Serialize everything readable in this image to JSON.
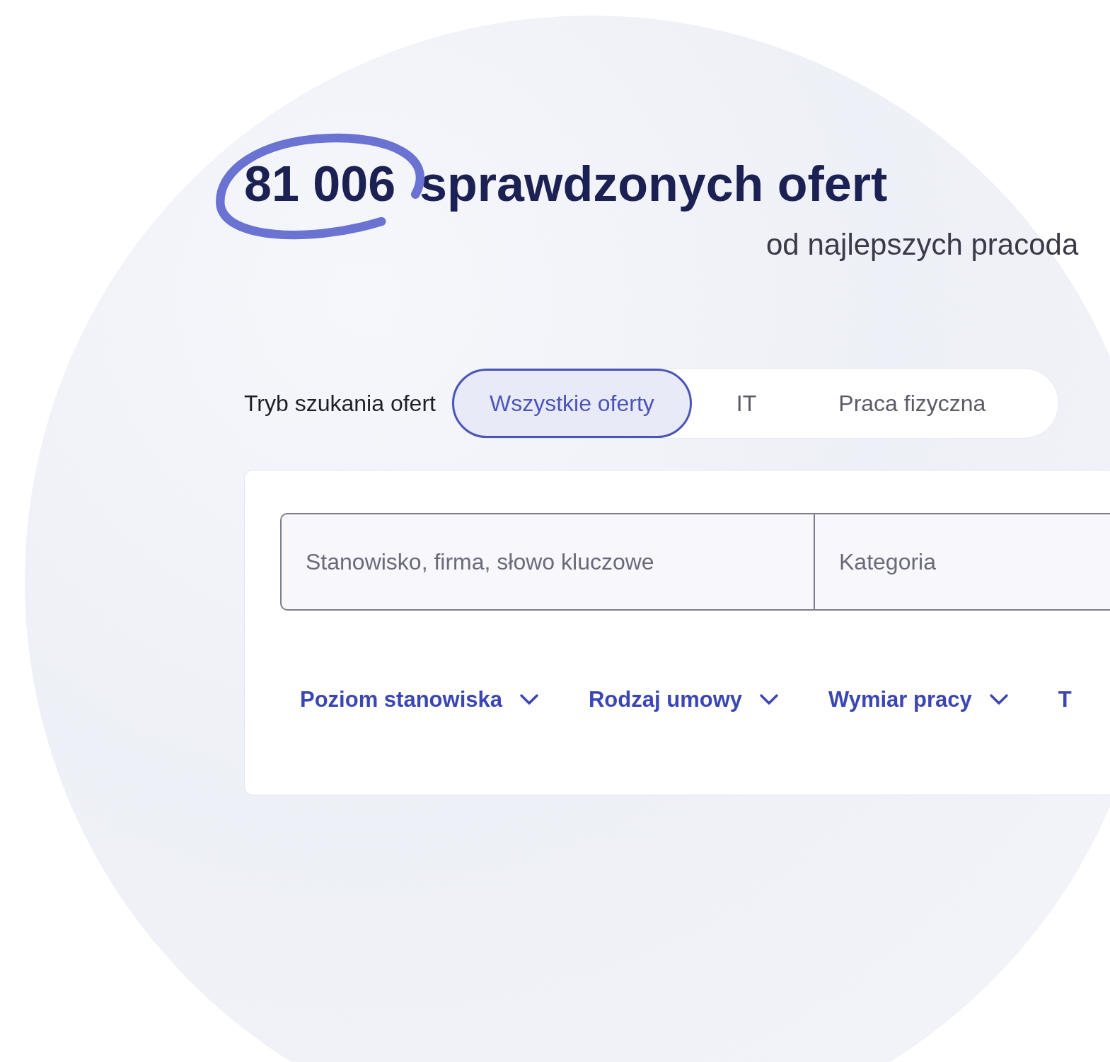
{
  "heading": {
    "count": "81 006",
    "text": "sprawdzonych ofert"
  },
  "subheading": "od najlepszych pracoda",
  "mode": {
    "label": "Tryb szukania ofert",
    "tabs": [
      {
        "label": "Wszystkie oferty",
        "selected": true
      },
      {
        "label": "IT",
        "selected": false
      },
      {
        "label": "Praca fizyczna",
        "selected": false
      }
    ]
  },
  "search": {
    "keyword": {
      "placeholder": "Stanowisko, firma, słowo kluczowe"
    },
    "category": {
      "placeholder": "Kategoria"
    }
  },
  "filters": [
    {
      "label": "Poziom stanowiska",
      "kind": "dropdown"
    },
    {
      "label": "Rodzaj umowy",
      "kind": "dropdown"
    },
    {
      "label": "Wymiar pracy",
      "kind": "dropdown"
    },
    {
      "label": "T",
      "kind": "cut"
    }
  ]
}
